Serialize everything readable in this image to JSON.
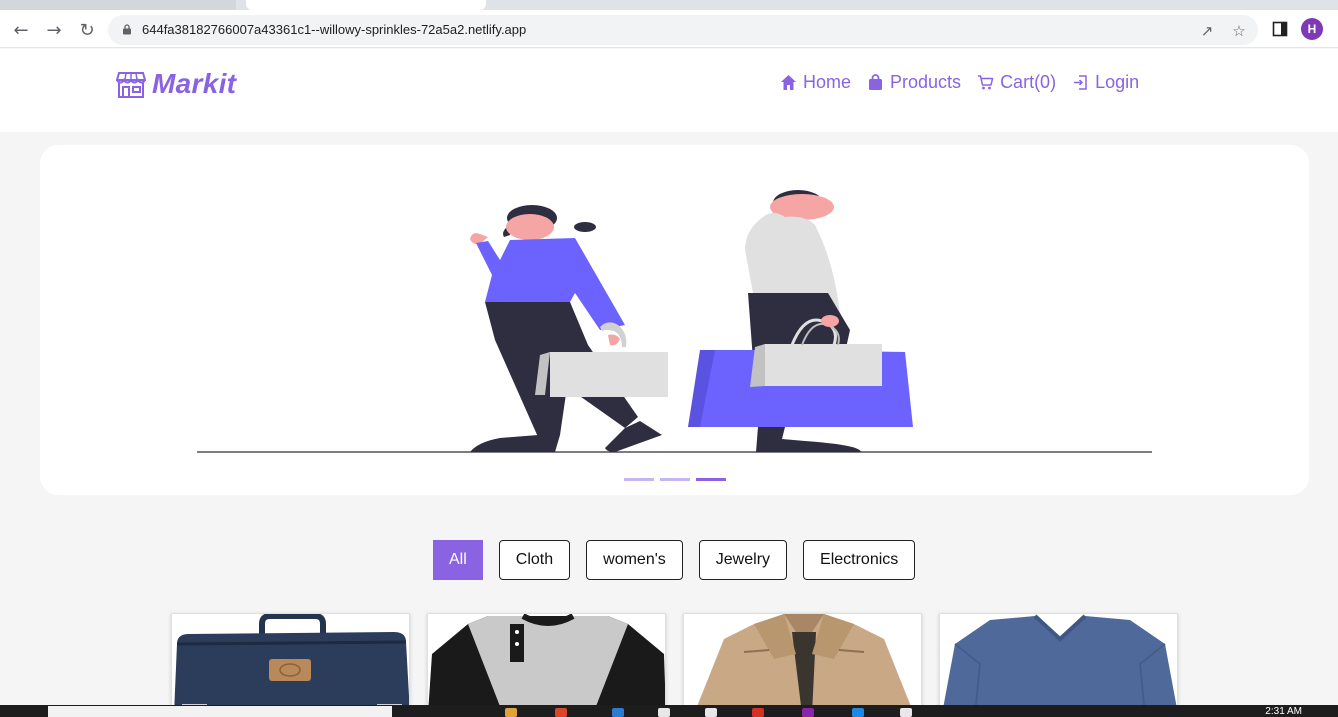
{
  "browser": {
    "url": "644fa38182766007a43361c1--willowy-sprinkles-72a5a2.netlify.app",
    "profile_initial": "H"
  },
  "site": {
    "brand": "Markit",
    "nav": [
      {
        "label": "Home",
        "icon": "home-icon"
      },
      {
        "label": "Products",
        "icon": "bag-icon"
      },
      {
        "label": "Cart(0)",
        "icon": "cart-icon"
      },
      {
        "label": "Login",
        "icon": "login-icon"
      }
    ]
  },
  "carousel": {
    "active_index": 2,
    "slide_count": 3
  },
  "filters": [
    {
      "label": "All",
      "active": true
    },
    {
      "label": "Cloth",
      "active": false
    },
    {
      "label": "women's",
      "active": false
    },
    {
      "label": "Jewelry",
      "active": false
    },
    {
      "label": "Electronics",
      "active": false
    }
  ],
  "products": [
    {
      "image": "navy-bag"
    },
    {
      "image": "raglan-henley-shirt"
    },
    {
      "image": "khaki-jacket"
    },
    {
      "image": "blue-vneck-tee"
    }
  ],
  "taskbar": {
    "clock": "2:31 AM"
  },
  "colors": {
    "accent": "#8a63e3",
    "illustration_purple": "#6c63ff",
    "dark": "#2f2e41"
  }
}
